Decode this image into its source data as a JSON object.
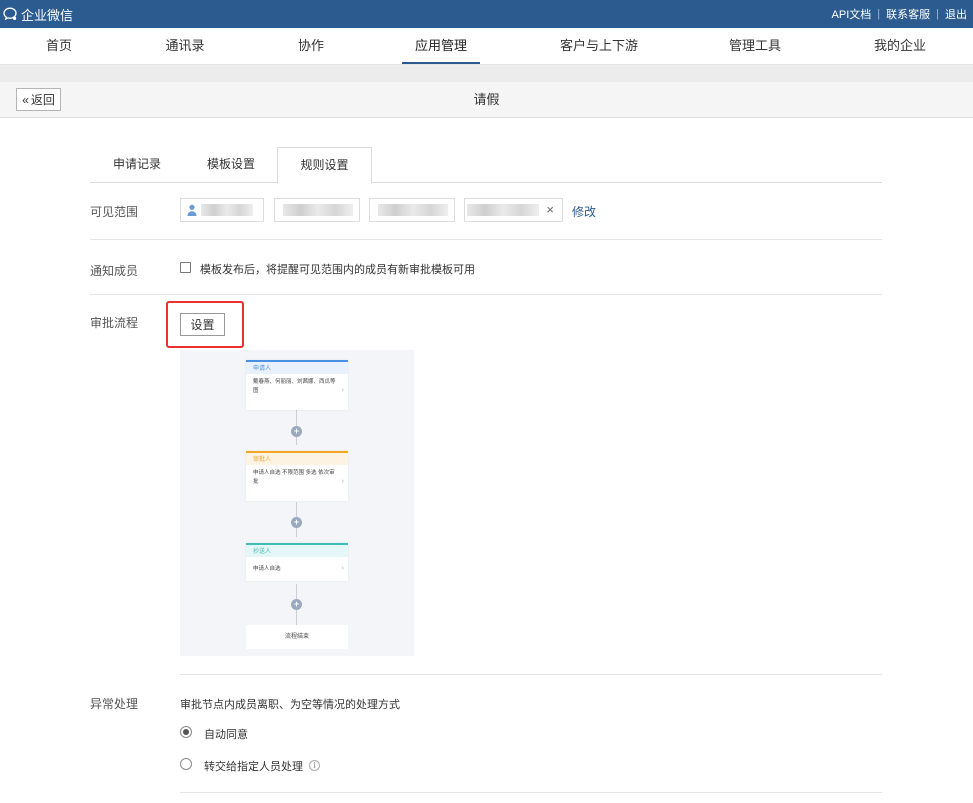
{
  "app": {
    "brand": "企业微信"
  },
  "toplinks": {
    "api": "API文档",
    "support": "联系客服",
    "logout": "退出",
    "separator": "|"
  },
  "nav": [
    {
      "label": "首页"
    },
    {
      "label": "通讯录"
    },
    {
      "label": "协作"
    },
    {
      "label": "应用管理",
      "active": true
    },
    {
      "label": "客户与上下游"
    },
    {
      "label": "管理工具"
    },
    {
      "label": "我的企业"
    }
  ],
  "titlebar": {
    "back_label": "返回",
    "back_arrow": "«",
    "title": "请假"
  },
  "tabs": [
    {
      "label": "申请记录"
    },
    {
      "label": "模板设置"
    },
    {
      "label": "规则设置",
      "active": true
    }
  ],
  "visibility": {
    "label": "可见范围",
    "remove_glyph": "×",
    "modify": "修改"
  },
  "notify": {
    "label": "通知成员",
    "checked": false,
    "text": "模板发布后，将提醒可见范围内的成员有新审批模板可用"
  },
  "approval": {
    "label": "审批流程",
    "set_button": "设置",
    "flow": {
      "nodes": [
        {
          "title": "申请人",
          "body": "戴春燕、何丽丽、刘茜娜、西瓜等图",
          "color": "#4a90e2",
          "head_bg": "#e8f1fc"
        },
        {
          "title": "审批人",
          "body": "申请人自选 不限范围 多选 依次审批",
          "color": "#f5a623",
          "head_bg": "#fdf3e3"
        },
        {
          "title": "抄送人",
          "body": "申请人自选",
          "color": "#3bbfb6",
          "head_bg": "#e4f6f5"
        }
      ],
      "plus_glyph": "+",
      "chevron_glyph": "›",
      "end": "流程结束"
    }
  },
  "exception": {
    "label": "异常处理",
    "description": "审批节点内成员离职、为空等情况的处理方式",
    "options": [
      {
        "label": "自动同意",
        "checked": true
      },
      {
        "label": "转交给指定人员处理",
        "checked": false
      }
    ],
    "info_glyph": "i"
  },
  "colors": {
    "topbar": "#2c5b8f",
    "highlight": "#e8322c",
    "link": "#2c5b8f"
  }
}
